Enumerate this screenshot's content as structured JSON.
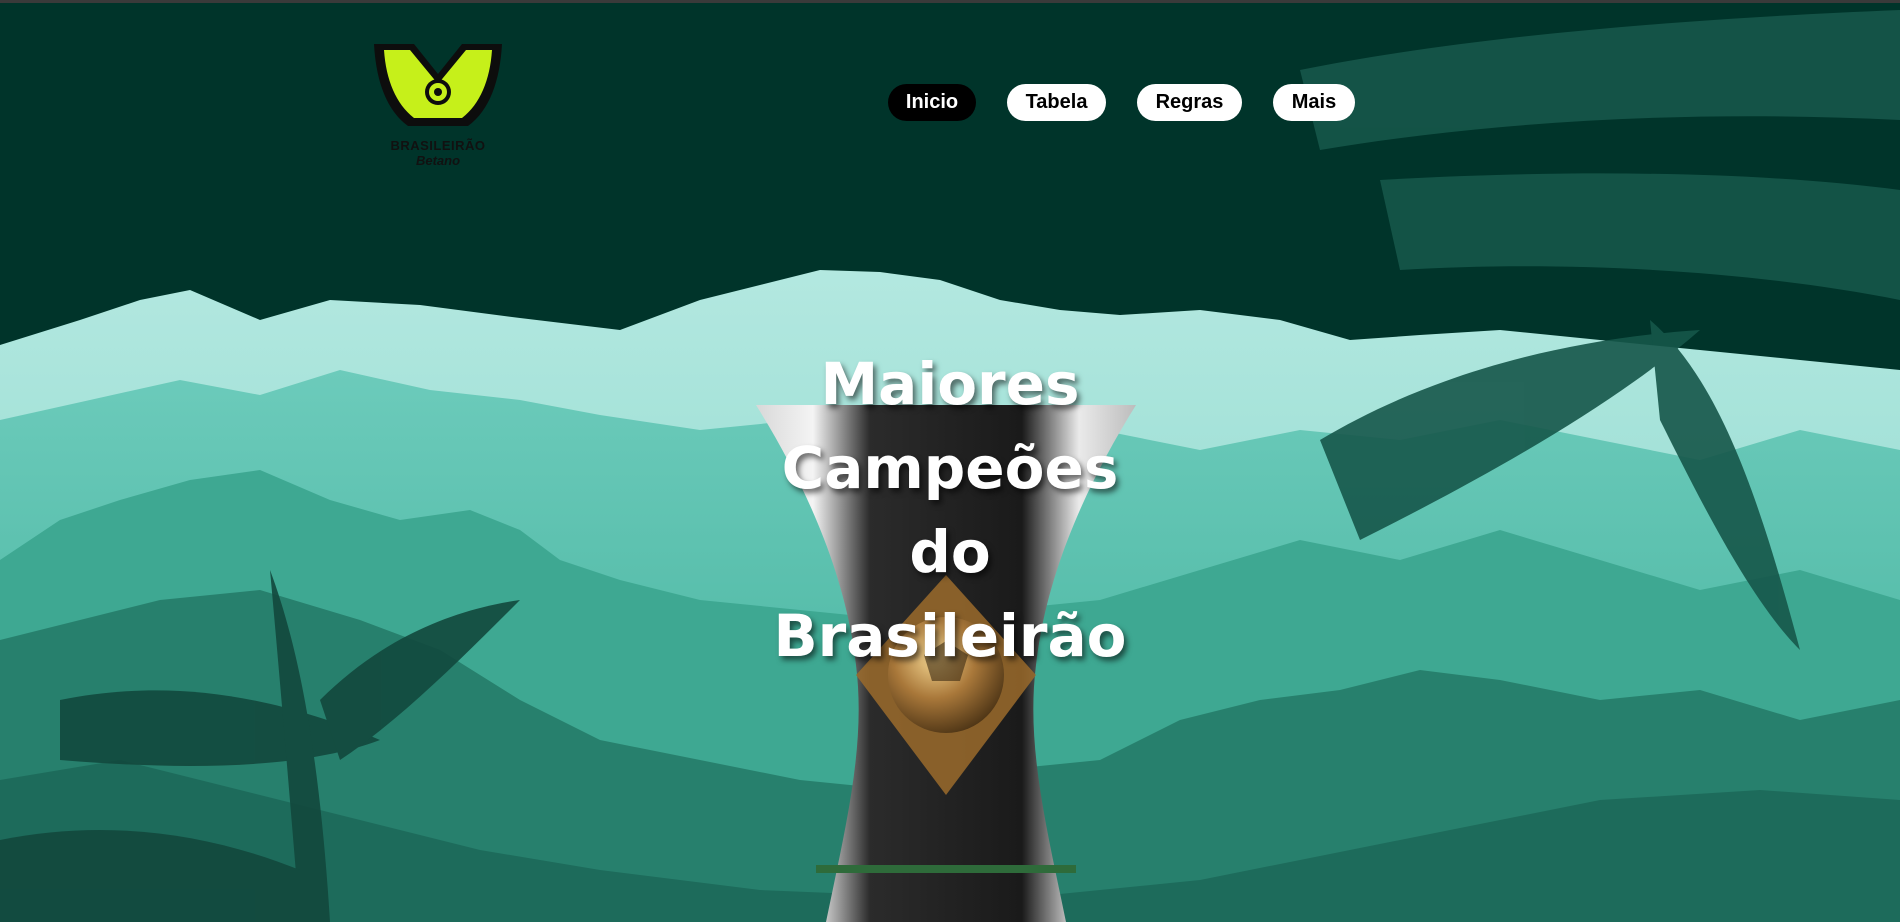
{
  "brand": {
    "logo_word": "BRASILEIRÃO",
    "logo_sponsor": "Betano",
    "logo_color": "#c6f01a"
  },
  "nav": {
    "items": [
      {
        "label": "Inicio",
        "active": true
      },
      {
        "label": "Tabela",
        "active": false
      },
      {
        "label": "Regras",
        "active": false
      },
      {
        "label": "Mais",
        "active": false
      }
    ]
  },
  "hero": {
    "title_line1": "Maiores Campeões",
    "title_line2": "do",
    "title_line3": "Brasileirão"
  },
  "colors": {
    "background": "#00342a",
    "mountain_far": "#a8e3da",
    "jungle_mid": "#3ea892",
    "jungle_dark": "#1e6a5a"
  },
  "icons": {
    "trophy": "trophy-icon",
    "logo": "brasileirao-logo-icon"
  }
}
